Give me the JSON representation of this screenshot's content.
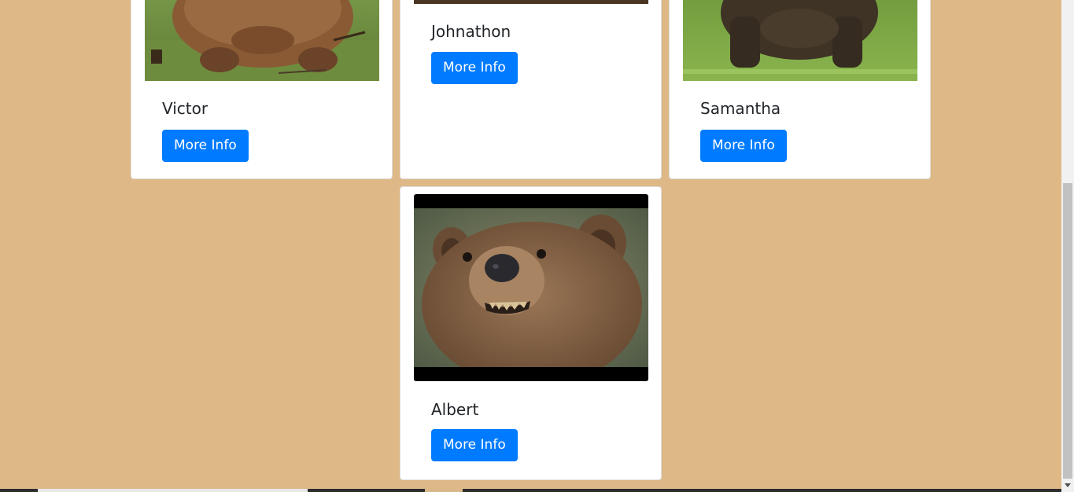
{
  "cards": [
    {
      "name": "Victor",
      "button_label": "More Info",
      "image_icon": "bear-photo"
    },
    {
      "name": "Johnathon",
      "button_label": "More Info",
      "image_icon": "bear-photo"
    },
    {
      "name": "Samantha",
      "button_label": "More Info",
      "image_icon": "bear-photo"
    },
    {
      "name": "Albert",
      "button_label": "More Info",
      "image_icon": "bear-photo"
    }
  ],
  "colors": {
    "page_background": "#deb887",
    "button": "#007bff",
    "card": "#ffffff"
  }
}
